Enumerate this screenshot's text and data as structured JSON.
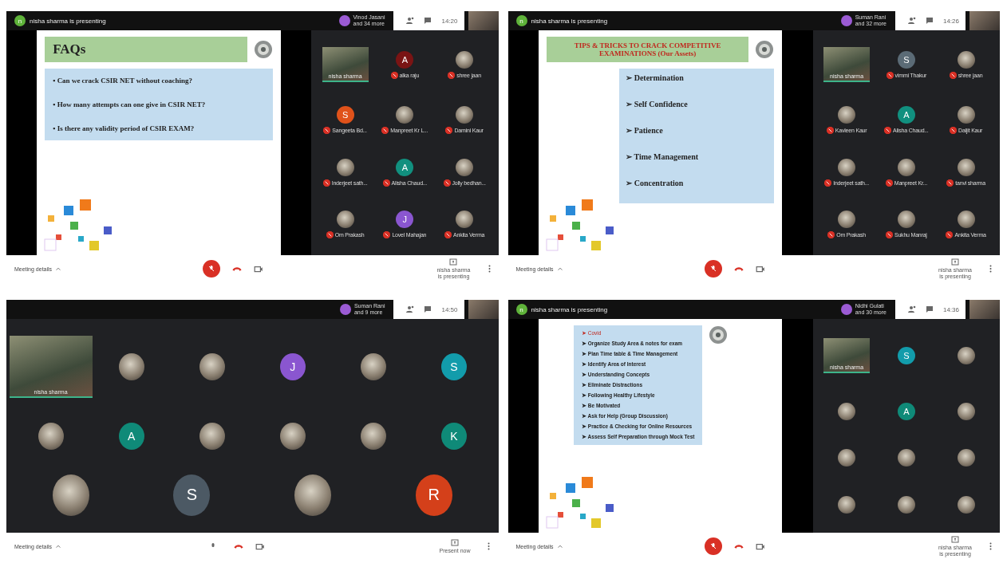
{
  "meetings": [
    {
      "presenting": {
        "initial": "n",
        "text": "nisha sharma is presenting"
      },
      "participants_chip": {
        "name": "Vinod Jasani",
        "more": "and 34 more"
      },
      "time": "14:20",
      "slide": {
        "kind": "faq",
        "title": "FAQs",
        "marker": "•",
        "items": [
          "Can we crack CSIR NET without coaching?",
          "How many attempts can one give in CSIR NET?",
          "Is there any validity period of CSIR EXAM?"
        ]
      },
      "tile_rows": [
        {
          "kind": "small",
          "tiles": [
            {
              "kind": "video",
              "name": "nisha sharma"
            },
            {
              "kind": "letter",
              "letter": "A",
              "color": "#7a1414",
              "name": "alka raju",
              "muted": true
            },
            {
              "kind": "photo",
              "name": "shree jaan",
              "muted": true
            }
          ]
        },
        {
          "kind": "small",
          "tiles": [
            {
              "kind": "letter",
              "letter": "S",
              "color": "#e0521a",
              "name": "Sangeeta Bd...",
              "muted": true
            },
            {
              "kind": "photo",
              "name": "Manpreet Kr L...",
              "muted": true
            },
            {
              "kind": "photo",
              "name": "Damini Kaur",
              "muted": true
            }
          ]
        },
        {
          "kind": "small",
          "tiles": [
            {
              "kind": "photo",
              "name": "Inderjeet sath...",
              "muted": true
            },
            {
              "kind": "letter",
              "letter": "A",
              "color": "#11907f",
              "name": "Alisha Chaud...",
              "muted": true
            },
            {
              "kind": "photo",
              "name": "Jolly bedhan...",
              "muted": true
            }
          ]
        },
        {
          "kind": "small",
          "tiles": [
            {
              "kind": "photo",
              "name": "Om Prakash",
              "muted": true
            },
            {
              "kind": "letter",
              "letter": "J",
              "color": "#8a56d0",
              "name": "Lovel Mahajan",
              "muted": true
            },
            {
              "kind": "photo",
              "name": "Ankita Verma",
              "muted": true
            }
          ]
        }
      ],
      "footer": {
        "details": "Meeting details",
        "mic_muted": true,
        "present": [
          "nisha sharma",
          "is presenting"
        ]
      }
    },
    {
      "presenting": {
        "initial": "n",
        "text": "nisha sharma is presenting"
      },
      "participants_chip": {
        "name": "Suman Rani",
        "more": "and 32 more"
      },
      "time": "14:26",
      "slide": {
        "kind": "tips",
        "title": "TIPS & TRICKS TO CRACK COMPETITIVE EXAMINATIONS (Our Assets)",
        "marker": "➢",
        "items": [
          "Determination",
          "Self Confidence",
          "Patience",
          "Time Management",
          "Concentration"
        ]
      },
      "tile_rows": [
        {
          "kind": "small",
          "tiles": [
            {
              "kind": "video",
              "name": "nisha sharma"
            },
            {
              "kind": "letter",
              "letter": "S",
              "color": "#5b6b76",
              "name": "vimmi Thakur",
              "muted": true
            },
            {
              "kind": "photo",
              "name": "shree jaan",
              "muted": true
            }
          ]
        },
        {
          "kind": "small",
          "tiles": [
            {
              "kind": "photo",
              "name": "Kavleen Kaur",
              "muted": true
            },
            {
              "kind": "letter",
              "letter": "A",
              "color": "#11907f",
              "name": "Alisha Chaud...",
              "muted": true
            },
            {
              "kind": "photo",
              "name": "Daljit Kaur",
              "muted": true
            }
          ]
        },
        {
          "kind": "small",
          "tiles": [
            {
              "kind": "photo",
              "name": "Inderjeet sath...",
              "muted": true
            },
            {
              "kind": "photo",
              "name": "Manpreet Kr...",
              "muted": true
            },
            {
              "kind": "photo",
              "name": "tanvi sharma",
              "muted": true
            }
          ]
        },
        {
          "kind": "small",
          "tiles": [
            {
              "kind": "photo",
              "name": "Om Prakash",
              "muted": true
            },
            {
              "kind": "photo",
              "name": "Sukhu Manraj",
              "muted": true
            },
            {
              "kind": "photo",
              "name": "Ankita Verma",
              "muted": true
            }
          ]
        }
      ],
      "footer": {
        "details": "Meeting details",
        "mic_muted": true,
        "present": [
          "nisha sharma",
          "is presenting"
        ]
      }
    },
    {
      "participants_chip": {
        "name": "Suman Rani",
        "more": "and 9 more"
      },
      "time": "14:50",
      "tile_rows": [
        {
          "kind": "medium",
          "tiles": [
            {
              "kind": "video",
              "name": "nisha sharma"
            },
            {
              "kind": "photo"
            },
            {
              "kind": "photo"
            },
            {
              "kind": "letter",
              "letter": "J",
              "color": "#8a56d0"
            },
            {
              "kind": "photo"
            },
            {
              "kind": "letter",
              "letter": "S",
              "color": "#129cab"
            }
          ]
        },
        {
          "kind": "medium",
          "tiles": [
            {
              "kind": "photo"
            },
            {
              "kind": "letter",
              "letter": "A",
              "color": "#0f8a78"
            },
            {
              "kind": "photo"
            },
            {
              "kind": "photo"
            },
            {
              "kind": "photo"
            },
            {
              "kind": "letter",
              "letter": "K",
              "color": "#0f8a78"
            }
          ]
        },
        {
          "kind": "large",
          "tiles": [
            {
              "kind": "photo"
            },
            {
              "kind": "letter",
              "letter": "S",
              "color": "#4c5964"
            },
            {
              "kind": "photo"
            },
            {
              "kind": "letter",
              "letter": "R",
              "color": "#d4401a"
            }
          ]
        }
      ],
      "footer": {
        "details": "Meeting details",
        "mic_muted": false,
        "present": [
          "Present now"
        ]
      }
    },
    {
      "presenting": {
        "initial": "n",
        "text": "nisha sharma is presenting"
      },
      "participants_chip": {
        "name": "Nidhi Gulati",
        "more": "and 30 more"
      },
      "time": "14:36",
      "slide": {
        "kind": "list",
        "marker": "➤",
        "items": [
          "Covid",
          "Organize Study Area & notes for exam",
          "Plan Time table & Time Management",
          "Identify Area of Interest",
          "Understanding Concepts",
          "Eliminate Distractions",
          "Following Healthy Lifestyle",
          "Be Motivated",
          "Ask for Help (Group Discussion)",
          "Practice & Checking for Online Resources",
          "Assess Self Preparation through Mock Test"
        ]
      },
      "tile_rows": [
        {
          "kind": "small",
          "tiles": [
            {
              "kind": "video",
              "name": "nisha sharma"
            },
            {
              "kind": "letter",
              "letter": "S",
              "color": "#129cab"
            },
            {
              "kind": "photo"
            }
          ]
        },
        {
          "kind": "small",
          "tiles": [
            {
              "kind": "photo"
            },
            {
              "kind": "letter",
              "letter": "A",
              "color": "#0f8a78"
            },
            {
              "kind": "photo"
            }
          ]
        },
        {
          "kind": "small",
          "tiles": [
            {
              "kind": "photo"
            },
            {
              "kind": "photo"
            },
            {
              "kind": "photo"
            }
          ]
        },
        {
          "kind": "small",
          "tiles": [
            {
              "kind": "photo"
            },
            {
              "kind": "photo"
            },
            {
              "kind": "photo"
            }
          ]
        }
      ],
      "footer": {
        "details": "Meeting details",
        "mic_muted": true,
        "present": [
          "nisha sharma",
          "is presenting"
        ]
      }
    }
  ]
}
